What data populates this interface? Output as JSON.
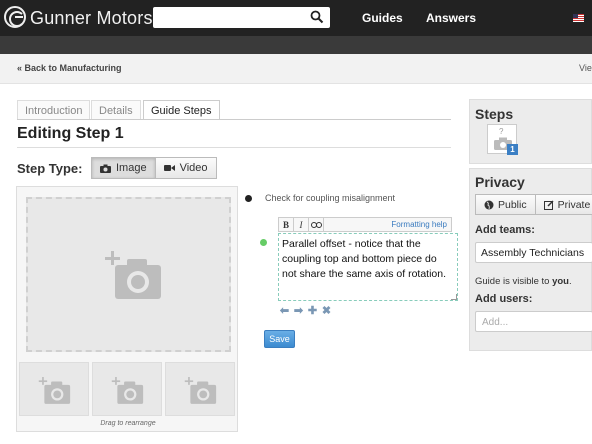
{
  "header": {
    "brand": "Gunner Motors",
    "search": {
      "value": "",
      "placeholder": ""
    },
    "nav": [
      "Guides",
      "Answers"
    ],
    "flag": "us-flag-icon"
  },
  "breadcrumb": {
    "back": "« Back to Manufacturing",
    "right": "Vie"
  },
  "tabs": [
    {
      "label": "Introduction",
      "active": false
    },
    {
      "label": "Details",
      "active": false
    },
    {
      "label": "Guide Steps",
      "active": true
    }
  ],
  "page_title": "Editing Step 1",
  "step_type": {
    "label": "Step Type:",
    "options": [
      {
        "label": "Image",
        "icon": "camera-icon",
        "active": true
      },
      {
        "label": "Video",
        "icon": "video-camera-icon",
        "active": false
      }
    ]
  },
  "media": {
    "drag_hint": "Drag to rearrange"
  },
  "bullets": [
    {
      "text": "Check for coupling misalignment",
      "color": "#222222"
    },
    {
      "text": "Parallel offset - notice that the coupling top and bottom piece do not share the same axis of rotation.",
      "color": "#66cc66"
    }
  ],
  "editor": {
    "toolbar": [
      "B",
      "I",
      "link-icon"
    ],
    "formatting_help": "Formatting help"
  },
  "save_label": "Save",
  "sidebar": {
    "steps": {
      "title": "Steps",
      "thumb_placeholder": "?",
      "badge": "1"
    },
    "privacy": {
      "title": "Privacy",
      "public_label": "Public",
      "private_label": "Private",
      "add_teams_label": "Add teams:",
      "team_selected": "Assembly Technicians",
      "visibility_prefix": "Guide is visible to",
      "visibility_target": "you",
      "visibility_suffix": ".",
      "add_users_label": "Add users:",
      "users_placeholder": "Add..."
    }
  },
  "colors": {
    "accent": "#3c8bd0",
    "nav_bg": "#222222",
    "badge": "#3b7fc4",
    "bullet_active": "#66cc66"
  }
}
